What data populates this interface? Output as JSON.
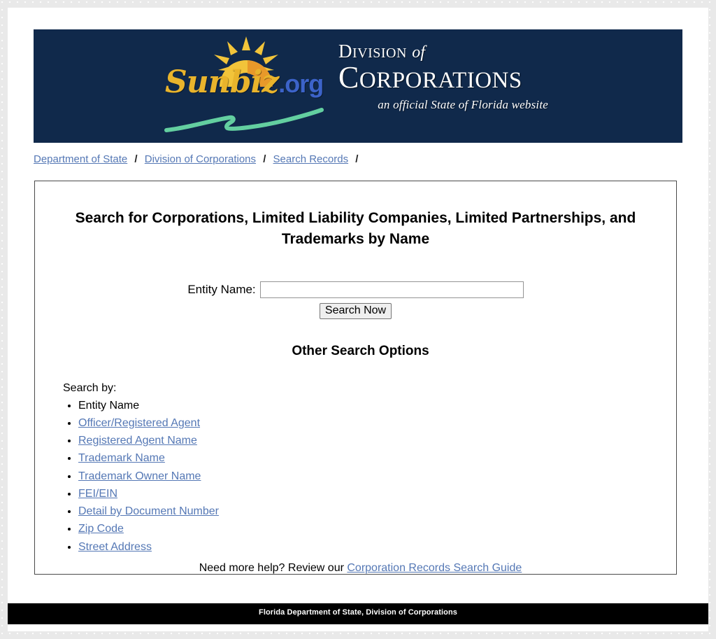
{
  "banner": {
    "logo_wordmark": "Sunbiz",
    "logo_tld": ".org",
    "division_line_1_a": "D",
    "division_line_1_b": "IVISION",
    "division_line_1_of": "of",
    "corporations_a": "C",
    "corporations_b": "ORPORATIONS",
    "tagline": "an official State of Florida website"
  },
  "breadcrumb": {
    "items": [
      {
        "label": "Department of State"
      },
      {
        "label": "Division of Corporations"
      },
      {
        "label": "Search Records"
      }
    ],
    "separator": "/"
  },
  "panel": {
    "title": "Search for Corporations, Limited Liability Companies, Limited Partnerships, and Trademarks by Name",
    "entity_name_label": "Entity Name:",
    "entity_name_value": "",
    "entity_name_placeholder": "",
    "search_button_label": "Search Now",
    "other_search_options_title": "Other Search Options",
    "search_by_label": "Search by:",
    "options": [
      {
        "label": "Entity Name",
        "is_link": false
      },
      {
        "label": "Officer/Registered Agent",
        "is_link": true
      },
      {
        "label": "Registered Agent Name",
        "is_link": true
      },
      {
        "label": "Trademark Name",
        "is_link": true
      },
      {
        "label": "Trademark Owner Name",
        "is_link": true
      },
      {
        "label": "FEI/EIN",
        "is_link": true
      },
      {
        "label": "Detail by Document Number",
        "is_link": true
      },
      {
        "label": "Zip Code",
        "is_link": true
      },
      {
        "label": "Street Address",
        "is_link": true
      }
    ],
    "help_prefix": "Need more help? Review our",
    "help_link_label": "Corporation Records Search Guide"
  },
  "footer": {
    "text": "Florida Department of State, Division of Corporations"
  },
  "colors": {
    "banner_navy": "#10294b",
    "link_blue": "#5578b5",
    "sun_gold": "#e9b42c",
    "org_blue": "#3c63c9",
    "swoosh_green": "#63cfa0",
    "footer_black": "#000000",
    "page_background": "#e9e9e9"
  }
}
